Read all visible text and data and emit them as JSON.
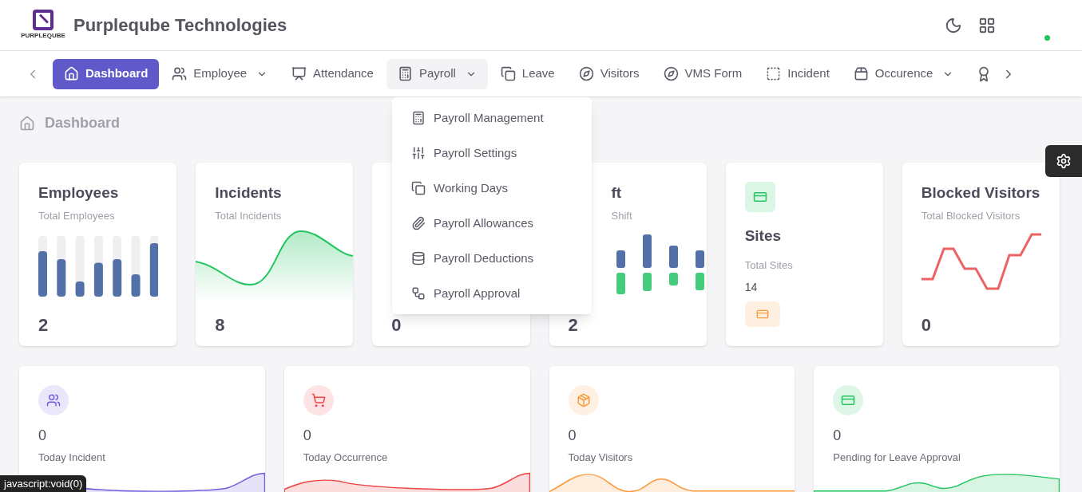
{
  "header": {
    "company": "Purpleqube Technologies",
    "logo_text": "PURPLEQUBE"
  },
  "nav": {
    "items": [
      {
        "label": "Dashboard",
        "selected": true,
        "has_caret": false,
        "expanded": false
      },
      {
        "label": "Employee",
        "selected": false,
        "has_caret": true,
        "expanded": false
      },
      {
        "label": "Attendance",
        "selected": false,
        "has_caret": false,
        "expanded": false
      },
      {
        "label": "Payroll",
        "selected": false,
        "has_caret": true,
        "expanded": true
      },
      {
        "label": "Leave",
        "selected": false,
        "has_caret": false,
        "expanded": false
      },
      {
        "label": "Visitors",
        "selected": false,
        "has_caret": false,
        "expanded": false
      },
      {
        "label": "VMS Form",
        "selected": false,
        "has_caret": false,
        "expanded": false
      },
      {
        "label": "Incident",
        "selected": false,
        "has_caret": false,
        "expanded": false
      },
      {
        "label": "Occurence",
        "selected": false,
        "has_caret": true,
        "expanded": false
      }
    ]
  },
  "payroll_menu": [
    "Payroll Management",
    "Payroll Settings",
    "Working Days",
    "Payroll Allowances",
    "Payroll Deductions",
    "Payroll Approval"
  ],
  "breadcrumb": "Dashboard",
  "stat_cards": [
    {
      "kind": "bars",
      "title": "Employees",
      "subtitle": "Total Employees",
      "value": "2"
    },
    {
      "kind": "wave",
      "title": "Incidents",
      "subtitle": "Total Incidents",
      "value": "8"
    },
    {
      "kind": "hidden",
      "value": "0"
    },
    {
      "kind": "pairs",
      "title": "ft",
      "subtitle": "Shift",
      "value": "2"
    },
    {
      "kind": "sites",
      "title": "Sites",
      "subtitle": "Total Sites",
      "value": "14"
    },
    {
      "kind": "line",
      "title": "Blocked Visitors",
      "subtitle": "Total Blocked Visitors",
      "value": "0"
    }
  ],
  "today_cards": [
    {
      "value": "0",
      "label": "Today Incident",
      "color": "#6f5fe0"
    },
    {
      "value": "0",
      "label": "Today Occurrence",
      "color": "#ef4444"
    },
    {
      "value": "0",
      "label": "Today Visitors",
      "color": "#fb9a3c"
    },
    {
      "value": "0",
      "label": "Pending for Leave Approval",
      "color": "#22c55e"
    }
  ],
  "status_tooltip": "javascript:void(0)"
}
